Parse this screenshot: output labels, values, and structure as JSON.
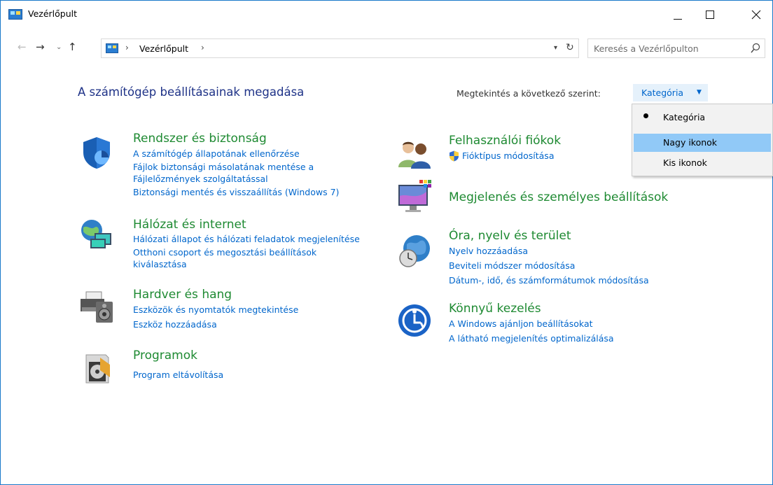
{
  "window": {
    "title": "Vezérlőpult",
    "buttons": {
      "minimize": "—",
      "maximize": "☐",
      "close": "✕"
    }
  },
  "address": {
    "crumb": "Vezérlőpult",
    "separator": "›",
    "search_placeholder": "Keresés a Vezérlőpulton"
  },
  "header": {
    "title": "A számítógép beállításainak megadása",
    "view_by_label": "Megtekintés a következő szerint:",
    "view_by_value": "Kategória"
  },
  "categories_left": [
    {
      "icon": "shield-icon",
      "title": "Rendszer és biztonság",
      "links": [
        "A számítógép állapotának ellenőrzése",
        "Fájlok biztonsági másolatának mentése a Fájlelőzmények szolgáltatással",
        "Biztonsági mentés és visszaállítás (Windows 7)"
      ]
    },
    {
      "icon": "network-globe-icon",
      "title": "Hálózat és internet",
      "links": [
        "Hálózati állapot és hálózati feladatok megjelenítése",
        "Otthoni csoport és megosztási beállítások kiválasztása"
      ]
    },
    {
      "icon": "printer-speaker-icon",
      "title": "Hardver és hang",
      "links": [
        "Eszközök és nyomtatók megtekintése",
        "Eszköz hozzáadása"
      ]
    },
    {
      "icon": "programs-disc-icon",
      "title": "Programok",
      "links": [
        "Program eltávolítása"
      ]
    }
  ],
  "categories_right": [
    {
      "icon": "users-icon",
      "title": "Felhasználói fiókok",
      "links": [
        "Fióktípus módosítása"
      ]
    },
    {
      "icon": "monitor-palette-icon",
      "title": "Megjelenés és személyes beállítások",
      "links": []
    },
    {
      "icon": "globe-clock-icon",
      "title": "Óra, nyelv és terület",
      "links": [
        "Nyelv hozzáadása",
        "Beviteli módszer módosítása",
        "Dátum-, idő, és számformátumok módosítása"
      ]
    },
    {
      "icon": "ease-of-access-icon",
      "title": "Könnyű kezelés",
      "links": [
        "A Windows ajánljon beállításokat",
        "A látható megjelenítés optimalizálása"
      ]
    }
  ],
  "view_menu": {
    "items": [
      "Kategória",
      "Nagy ikonok",
      "Kis ikonok"
    ],
    "selected": "Kategória",
    "hovered": "Nagy ikonok"
  },
  "colors": {
    "category_title": "#1e8a32",
    "link": "#0066cc",
    "page_title": "#1e3287",
    "menu_highlight": "#91c9f7"
  }
}
